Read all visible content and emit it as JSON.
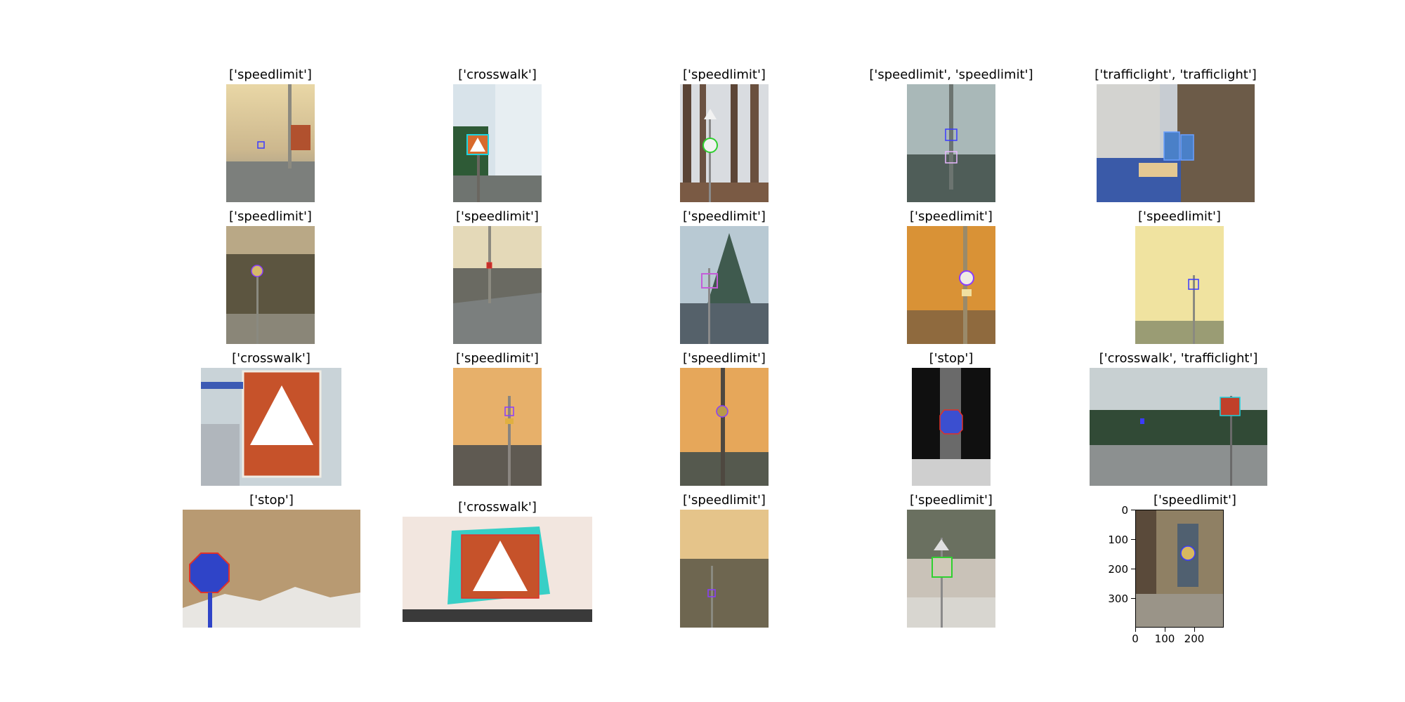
{
  "figure": {
    "panels": [
      {
        "title": "['speedlimit']"
      },
      {
        "title": "['crosswalk']"
      },
      {
        "title": "['speedlimit']"
      },
      {
        "title": "['speedlimit', 'speedlimit']"
      },
      {
        "title": "['trafficlight', 'trafficlight']"
      },
      {
        "title": "['speedlimit']"
      },
      {
        "title": "['speedlimit']"
      },
      {
        "title": "['speedlimit']"
      },
      {
        "title": "['speedlimit']"
      },
      {
        "title": "['speedlimit']"
      },
      {
        "title": "['crosswalk']"
      },
      {
        "title": "['speedlimit']"
      },
      {
        "title": "['speedlimit']"
      },
      {
        "title": "['stop']"
      },
      {
        "title": "['crosswalk', 'trafficlight']"
      },
      {
        "title": "['stop']"
      },
      {
        "title": "['crosswalk']"
      },
      {
        "title": "['speedlimit']"
      },
      {
        "title": "['speedlimit']"
      },
      {
        "title": "['speedlimit']"
      }
    ],
    "last_panel_axes": {
      "y_ticks": [
        "0",
        "100",
        "200",
        "300"
      ],
      "x_ticks": [
        "0",
        "100",
        "200"
      ]
    },
    "colors": {
      "box_blue": "#3b3bff",
      "box_cyan": "#1ed3e0",
      "box_purple": "#8a3cff",
      "box_red": "#e0302a",
      "box_green": "#2fd02f"
    }
  }
}
